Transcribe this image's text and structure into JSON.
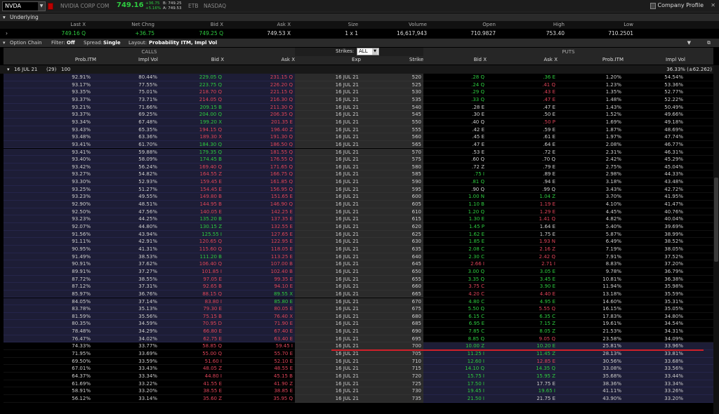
{
  "topbar": {
    "symbol": "NVDA",
    "company": "NVIDIA CORP COM",
    "last": "749.16",
    "chg_line1": "+36.75",
    "chg_line2": "+5.16%",
    "bid_mini": "B: 749.25",
    "ask_mini": "A: 749.53",
    "etb": "ETB",
    "exchange": "NASDAQ",
    "company_profile": "Company Profile"
  },
  "underlying": {
    "title": "Underlying",
    "headers": [
      "Last X",
      "Net Chng",
      "Bid X",
      "Ask X",
      "Size",
      "Volume",
      "Open",
      "High",
      "Low"
    ],
    "values": [
      "749.16 Q",
      "+36.75",
      "749.25 Q",
      "749.53 X",
      "1 x 1",
      "16,617,943",
      "710.9827",
      "753.40",
      "710.2501"
    ]
  },
  "chain": {
    "title": "Option Chain",
    "filter_label": "Filter:",
    "filter": "Off",
    "spread_label": "Spread:",
    "spread": "Single",
    "layout_label": "Layout:",
    "layout": "Probability ITM, Impl Vol"
  },
  "headers": {
    "calls": "CALLS",
    "puts": "PUTS",
    "strikes_label": "Strikes:",
    "strikes_value": "ALL",
    "call_cols": [
      "Prob.ITM",
      "Impl Vol",
      "Bid X",
      "Ask X"
    ],
    "mid_cols": [
      "Exp",
      "Strike"
    ],
    "put_cols": [
      "Bid X",
      "Ask X",
      "Prob.ITM",
      "Impl Vol"
    ]
  },
  "exp_row": {
    "label": "16 JUL 21",
    "count": "(29)",
    "mult": "100",
    "iv": "36.33% (±62.262)"
  },
  "colors": {
    "red": "#e0455a",
    "green": "#2ecc40",
    "text": "#cfcfcf",
    "call_bg": "#1d1d36",
    "line": "#d0202a"
  },
  "rows": [
    [
      "92.91%",
      "80.44%",
      "229.05 Q",
      "231.15 Q",
      "16 JUL 21",
      "520",
      ".28 Q",
      ".36 E",
      "1.20%",
      "54.54%"
    ],
    [
      "93.17%",
      "77.55%",
      "223.75 Q",
      "226.20 Q",
      "16 JUL 21",
      "525",
      ".24 Q",
      ".41 Q",
      "1.23%",
      "53.36%"
    ],
    [
      "93.35%",
      "75.01%",
      "218.70 Q",
      "221.15 Q",
      "16 JUL 21",
      "530",
      ".29 Q",
      ".43 E",
      "1.35%",
      "52.77%"
    ],
    [
      "93.37%",
      "73.71%",
      "214.05 Q",
      "216.30 Q",
      "16 JUL 21",
      "535",
      ".33 Q",
      ".47 E",
      "1.48%",
      "52.22%"
    ],
    [
      "93.21%",
      "71.66%",
      "209.15 B",
      "211.30 Q",
      "16 JUL 21",
      "540",
      ".28 E",
      ".47 E",
      "1.43%",
      "50.49%"
    ],
    [
      "93.37%",
      "69.25%",
      "204.00 Q",
      "206.35 Q",
      "16 JUL 21",
      "545",
      ".30 E",
      ".50 E",
      "1.52%",
      "49.66%"
    ],
    [
      "93.34%",
      "67.48%",
      "199.20 X",
      "201.35 E",
      "16 JUL 21",
      "550",
      ".40 Q",
      ".50 P",
      "1.69%",
      "49.18%"
    ],
    [
      "93.43%",
      "65.35%",
      "194.15 Q",
      "196.40 Z",
      "16 JUL 21",
      "555",
      ".42 E",
      ".59 E",
      "1.87%",
      "48.69%"
    ],
    [
      "93.48%",
      "63.36%",
      "189.30 X",
      "191.30 Q",
      "16 JUL 21",
      "560",
      ".45 E",
      ".61 E",
      "1.97%",
      "47.74%"
    ],
    [
      "93.41%",
      "61.70%",
      "184.30 Q",
      "186.50 Q",
      "16 JUL 21",
      "565",
      ".47 E",
      ".64 E",
      "2.08%",
      "46.77%"
    ],
    [
      "93.41%",
      "59.88%",
      "179.35 Q",
      "181.55 Q",
      "16 JUL 21",
      "570",
      ".53 E",
      ".72 E",
      "2.31%",
      "46.31%"
    ],
    [
      "93.40%",
      "58.09%",
      "174.45 B",
      "176.55 Q",
      "16 JUL 21",
      "575",
      ".60 Q",
      ".70 Q",
      "2.42%",
      "45.29%"
    ],
    [
      "93.42%",
      "56.24%",
      "169.40 Q",
      "171.65 Q",
      "16 JUL 21",
      "580",
      ".72 Z",
      ".79 E",
      "2.75%",
      "45.04%"
    ],
    [
      "93.27%",
      "54.82%",
      "164.55 Z",
      "166.75 Q",
      "16 JUL 21",
      "585",
      ".75 I",
      ".89 E",
      "2.98%",
      "44.33%"
    ],
    [
      "93.30%",
      "52.93%",
      "159.45 E",
      "161.85 Q",
      "16 JUL 21",
      "590",
      ".81 Q",
      ".94 E",
      "3.18%",
      "43.48%"
    ],
    [
      "93.25%",
      "51.27%",
      "154.45 E",
      "156.95 Q",
      "16 JUL 21",
      "595",
      ".90 Q",
      ".99 Q",
      "3.43%",
      "42.72%"
    ],
    [
      "93.23%",
      "49.55%",
      "149.80 B",
      "151.65 E",
      "16 JUL 21",
      "600",
      "1.00 N",
      "1.04 Z",
      "3.70%",
      "41.95%"
    ],
    [
      "92.90%",
      "48.51%",
      "144.95 B",
      "146.90 Q",
      "16 JUL 21",
      "605",
      "1.10 B",
      "1.19 E",
      "4.10%",
      "41.47%"
    ],
    [
      "92.50%",
      "47.56%",
      "140.05 E",
      "142.25 E",
      "16 JUL 21",
      "610",
      "1.20 Q",
      "1.29 E",
      "4.45%",
      "40.76%"
    ],
    [
      "93.23%",
      "44.25%",
      "135.20 B",
      "137.35 E",
      "16 JUL 21",
      "615",
      "1.30 E",
      "1.41 Q",
      "4.82%",
      "40.04%"
    ],
    [
      "92.07%",
      "44.80%",
      "130.15 Z",
      "132.55 E",
      "16 JUL 21",
      "620",
      "1.45 P",
      "1.64 E",
      "5.40%",
      "39.69%"
    ],
    [
      "91.56%",
      "43.94%",
      "125.55 I",
      "127.65 E",
      "16 JUL 21",
      "625",
      "1.62 E",
      "1.75 E",
      "5.87%",
      "38.99%"
    ],
    [
      "91.11%",
      "42.91%",
      "120.65 Q",
      "122.95 E",
      "16 JUL 21",
      "630",
      "1.85 E",
      "1.93 N",
      "6.49%",
      "38.52%"
    ],
    [
      "90.95%",
      "41.31%",
      "115.60 Q",
      "118.05 E",
      "16 JUL 21",
      "635",
      "2.08 C",
      "2.16 Z",
      "7.19%",
      "38.05%"
    ],
    [
      "91.49%",
      "38.53%",
      "111.20 B",
      "113.25 E",
      "16 JUL 21",
      "640",
      "2.30 C",
      "2.42 Q",
      "7.91%",
      "37.52%"
    ],
    [
      "90.91%",
      "37.62%",
      "106.40 Q",
      "107.00 B",
      "16 JUL 21",
      "645",
      "2.66 I",
      "2.71 I",
      "8.83%",
      "37.20%"
    ],
    [
      "89.91%",
      "37.27%",
      "101.85 I",
      "102.40 B",
      "16 JUL 21",
      "650",
      "3.00 Q",
      "3.05 E",
      "9.78%",
      "36.79%"
    ],
    [
      "87.72%",
      "38.55%",
      "97.05 E",
      "99.35 E",
      "16 JUL 21",
      "655",
      "3.35 Q",
      "3.45 E",
      "10.81%",
      "36.38%"
    ],
    [
      "87.12%",
      "37.31%",
      "92.65 B",
      "94.10 E",
      "16 JUL 21",
      "660",
      "3.75 C",
      "3.90 E",
      "11.94%",
      "35.98%"
    ],
    [
      "85.97%",
      "36.76%",
      "88.15 Q",
      "89.55 X",
      "16 JUL 21",
      "665",
      "4.20 C",
      "4.40 E",
      "13.18%",
      "35.59%"
    ],
    [
      "84.05%",
      "37.14%",
      "83.80 I",
      "85.80 E",
      "16 JUL 21",
      "670",
      "4.80 C",
      "4.95 E",
      "14.60%",
      "35.31%"
    ],
    [
      "83.78%",
      "35.13%",
      "79.30 E",
      "80.05 E",
      "16 JUL 21",
      "675",
      "5.50 Q",
      "5.55 Q",
      "16.15%",
      "35.05%"
    ],
    [
      "81.59%",
      "35.56%",
      "75.15 B",
      "76.40 X",
      "16 JUL 21",
      "680",
      "6.15 C",
      "6.35 C",
      "17.83%",
      "34.80%"
    ],
    [
      "80.35%",
      "34.59%",
      "70.95 D",
      "71.90 E",
      "16 JUL 21",
      "685",
      "6.95 E",
      "7.15 Z",
      "19.61%",
      "34.54%"
    ],
    [
      "78.48%",
      "34.29%",
      "66.80 E",
      "67.40 E",
      "16 JUL 21",
      "690",
      "7.85 C",
      "8.05 Z",
      "21.53%",
      "34.31%"
    ],
    [
      "76.47%",
      "34.02%",
      "62.75 E",
      "63.40 E",
      "16 JUL 21",
      "695",
      "8.85 Q",
      "9.05 Q",
      "23.58%",
      "34.09%"
    ],
    [
      "74.33%",
      "33.77%",
      "58.85 Q",
      "59.45 I",
      "16 JUL 21",
      "700",
      "10.00 Z",
      "10.20 E",
      "25.81%",
      "33.96%"
    ],
    [
      "71.95%",
      "33.69%",
      "55.00 Q",
      "55.70 E",
      "16 JUL 21",
      "705",
      "11.25 I",
      "11.45 Z",
      "28.13%",
      "33.81%"
    ],
    [
      "69.50%",
      "33.59%",
      "51.60 I",
      "52.10 E",
      "16 JUL 21",
      "710",
      "12.60 I",
      "12.85 E",
      "30.56%",
      "33.68%"
    ],
    [
      "67.01%",
      "33.43%",
      "48.05 Z",
      "48.55 E",
      "16 JUL 21",
      "715",
      "14.10 Q",
      "14.35 Q",
      "33.08%",
      "33.56%"
    ],
    [
      "64.37%",
      "33.34%",
      "44.80 I",
      "45.15 B",
      "16 JUL 21",
      "720",
      "15.75 I",
      "15.95 Z",
      "35.68%",
      "33.44%"
    ],
    [
      "61.69%",
      "33.22%",
      "41.55 E",
      "41.90 Z",
      "16 JUL 21",
      "725",
      "17.50 I",
      "17.75 E",
      "38.36%",
      "33.34%"
    ],
    [
      "58.91%",
      "33.20%",
      "38.55 E",
      "38.85 E",
      "16 JUL 21",
      "730",
      "19.45 I",
      "19.65 I",
      "41.11%",
      "33.26%"
    ],
    [
      "56.12%",
      "33.14%",
      "35.60 Z",
      "35.95 Q",
      "16 JUL 21",
      "735",
      "21.50 I",
      "21.75 E",
      "43.90%",
      "33.20%"
    ]
  ],
  "row_colors": [
    [
      "g",
      "r",
      "g",
      "g"
    ],
    [
      "g",
      "r",
      "g",
      "r"
    ],
    [
      "r",
      "r",
      "g",
      "r"
    ],
    [
      "r",
      "r",
      "g",
      "r"
    ],
    [
      "g",
      "r",
      "w",
      "w"
    ],
    [
      "g",
      "r",
      "w",
      "w"
    ],
    [
      "g",
      "r",
      "w",
      "r"
    ],
    [
      "r",
      "r",
      "w",
      "w"
    ],
    [
      "r",
      "r",
      "w",
      "w"
    ],
    [
      "g",
      "r",
      "w",
      "w"
    ],
    [
      "g",
      "r",
      "w",
      "w"
    ],
    [
      "g",
      "r",
      "w",
      "w"
    ],
    [
      "r",
      "r",
      "w",
      "w"
    ],
    [
      "r",
      "r",
      "g",
      "w"
    ],
    [
      "r",
      "r",
      "g",
      "w"
    ],
    [
      "r",
      "r",
      "w",
      "w"
    ],
    [
      "r",
      "r",
      "g",
      "g"
    ],
    [
      "r",
      "r",
      "g",
      "r"
    ],
    [
      "r",
      "r",
      "g",
      "r"
    ],
    [
      "g",
      "r",
      "g",
      "r"
    ],
    [
      "g",
      "r",
      "g",
      "w"
    ],
    [
      "g",
      "r",
      "g",
      "w"
    ],
    [
      "r",
      "r",
      "g",
      "r"
    ],
    [
      "r",
      "r",
      "g",
      "r"
    ],
    [
      "g",
      "r",
      "g",
      "r"
    ],
    [
      "r",
      "r",
      "r",
      "r"
    ],
    [
      "r",
      "r",
      "g",
      "g"
    ],
    [
      "r",
      "r",
      "g",
      "g"
    ],
    [
      "r",
      "r",
      "r",
      "g"
    ],
    [
      "r",
      "g",
      "r",
      "r"
    ],
    [
      "r",
      "g",
      "g",
      "g"
    ],
    [
      "r",
      "r",
      "g",
      "r"
    ],
    [
      "r",
      "r",
      "g",
      "g"
    ],
    [
      "r",
      "r",
      "g",
      "g"
    ],
    [
      "r",
      "r",
      "g",
      "g"
    ],
    [
      "r",
      "r",
      "g",
      "r"
    ],
    [
      "r",
      "r",
      "g",
      "g"
    ],
    [
      "r",
      "r",
      "g",
      "g"
    ],
    [
      "r",
      "r",
      "g",
      "r"
    ],
    [
      "r",
      "r",
      "g",
      "g"
    ],
    [
      "r",
      "r",
      "g",
      "g"
    ],
    [
      "r",
      "r",
      "g",
      "w"
    ],
    [
      "r",
      "r",
      "g",
      "g"
    ],
    [
      "r",
      "r",
      "g",
      "w"
    ]
  ]
}
